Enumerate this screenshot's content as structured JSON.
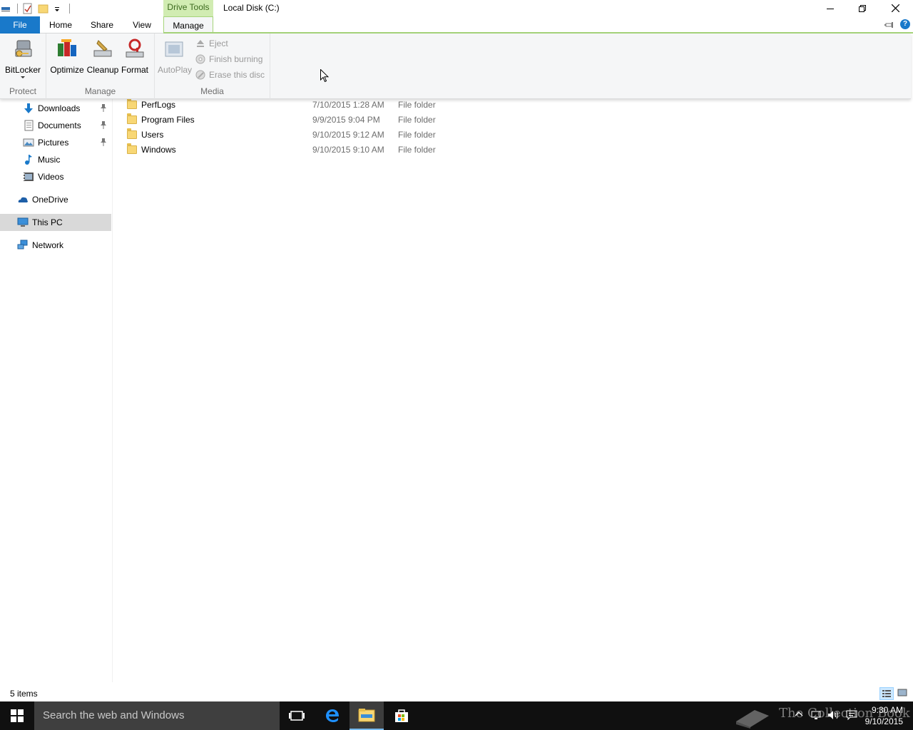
{
  "titlebar": {
    "context_tab": "Drive Tools",
    "title": "Local Disk (C:)",
    "buttons": [
      "minimize",
      "restore",
      "close"
    ]
  },
  "ribbon_tabs": {
    "file": "File",
    "home": "Home",
    "share": "Share",
    "view": "View",
    "manage": "Manage"
  },
  "ribbon": {
    "groups": {
      "protect": {
        "label": "Protect",
        "bitlocker": "BitLocker"
      },
      "manage": {
        "label": "Manage",
        "optimize": "Optimize",
        "cleanup": "Cleanup",
        "format": "Format"
      },
      "media": {
        "label": "Media",
        "autoplay": "AutoPlay",
        "eject": "Eject",
        "finish_burning": "Finish burning",
        "erase_disc": "Erase this disc"
      }
    }
  },
  "nav": {
    "items": [
      {
        "label": "Downloads",
        "icon": "download-arrow-icon",
        "pinned": true
      },
      {
        "label": "Documents",
        "icon": "documents-icon",
        "pinned": true
      },
      {
        "label": "Pictures",
        "icon": "pictures-icon",
        "pinned": true
      },
      {
        "label": "Music",
        "icon": "music-icon",
        "pinned": false
      },
      {
        "label": "Videos",
        "icon": "videos-icon",
        "pinned": false
      },
      {
        "label": "OneDrive",
        "icon": "onedrive-icon",
        "pinned": false
      },
      {
        "label": "This PC",
        "icon": "this-pc-icon",
        "pinned": false,
        "selected": true
      },
      {
        "label": "Network",
        "icon": "network-icon",
        "pinned": false
      }
    ]
  },
  "files": {
    "rows": [
      {
        "name": "PerfLogs",
        "date": "7/10/2015 1:28 AM",
        "type": "File folder"
      },
      {
        "name": "Program Files",
        "date": "9/9/2015 9:04 PM",
        "type": "File folder"
      },
      {
        "name": "Users",
        "date": "9/10/2015 9:12 AM",
        "type": "File folder"
      },
      {
        "name": "Windows",
        "date": "9/10/2015 9:10 AM",
        "type": "File folder"
      }
    ]
  },
  "status": {
    "count": "5 items"
  },
  "taskbar": {
    "search_placeholder": "Search the web and Windows",
    "time": "9:30 AM",
    "date": "9/10/2015",
    "watermark": "The Collection Book"
  },
  "colors": {
    "file_tab": "#1979ca",
    "context_green": "#d1ecb2",
    "selected_nav": "#d9d9d9",
    "taskbar": "#101010"
  }
}
